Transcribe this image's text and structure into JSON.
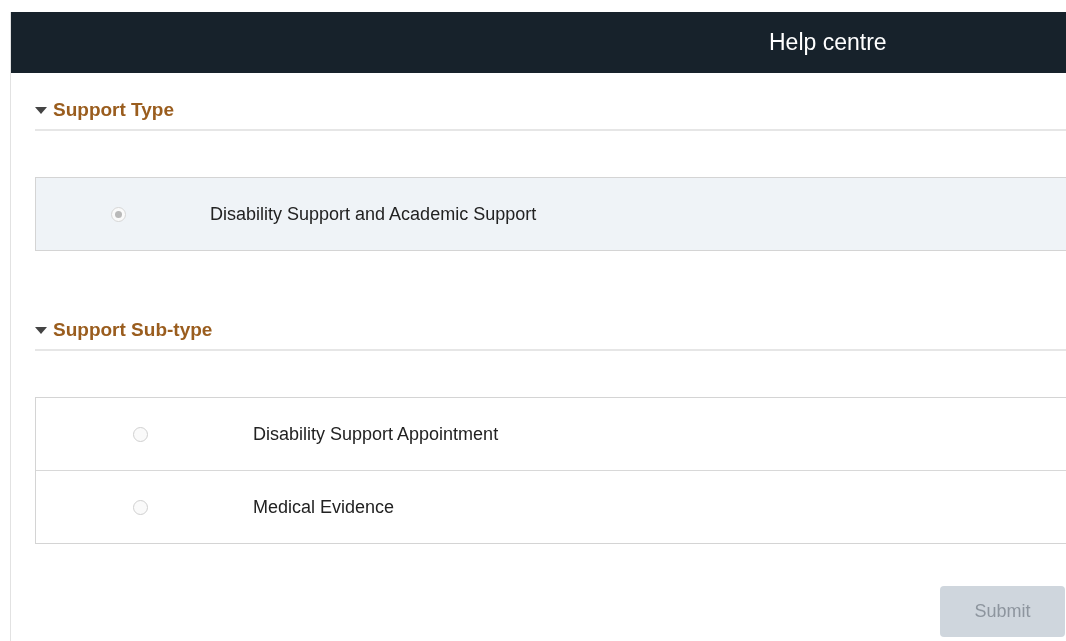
{
  "header": {
    "title": "Help centre"
  },
  "sections": [
    {
      "title": "Support Type",
      "expanded": true,
      "options": [
        {
          "label": "Disability Support and Academic Support",
          "selected": true
        }
      ]
    },
    {
      "title": "Support Sub-type",
      "expanded": true,
      "options": [
        {
          "label": "Disability Support Appointment",
          "selected": false
        },
        {
          "label": "Medical Evidence",
          "selected": false
        }
      ]
    }
  ],
  "submit": {
    "label": "Submit",
    "disabled": true
  }
}
